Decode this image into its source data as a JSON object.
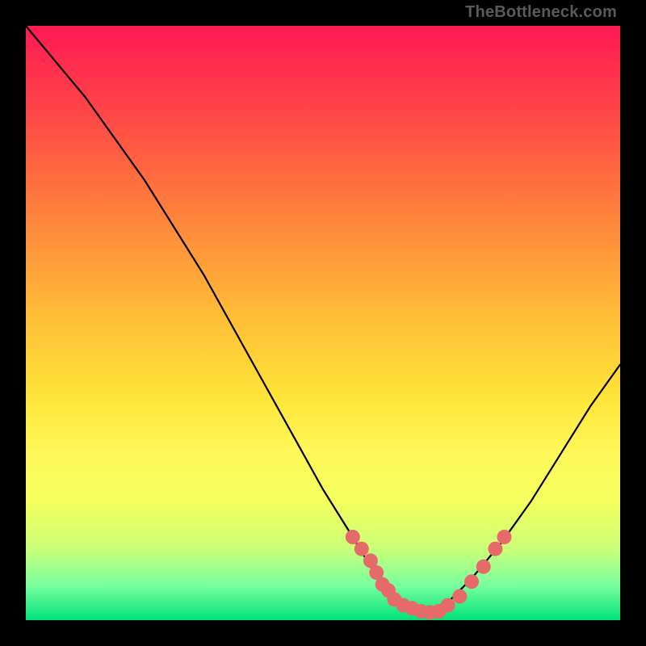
{
  "watermark": "TheBottleneck.com",
  "colors": {
    "frame": "#000000",
    "gradient_top": "#ff1a53",
    "gradient_bottom": "#00e37a",
    "curve": "#000000",
    "marker": "#e66a6a"
  },
  "chart_data": {
    "type": "line",
    "title": "",
    "xlabel": "",
    "ylabel": "",
    "xlim": [
      0,
      100
    ],
    "ylim": [
      0,
      100
    ],
    "x": [
      0,
      5,
      10,
      15,
      20,
      25,
      30,
      35,
      40,
      45,
      50,
      55,
      58,
      60,
      62,
      65,
      68,
      70,
      75,
      80,
      85,
      90,
      95,
      100
    ],
    "values": [
      100,
      94,
      88,
      81,
      74,
      66,
      58,
      49,
      40,
      31,
      22,
      14,
      9,
      6,
      4,
      2,
      1,
      2,
      7,
      13,
      20,
      28,
      36,
      43
    ],
    "markers": [
      {
        "x": 55,
        "y": 14
      },
      {
        "x": 56.5,
        "y": 12
      },
      {
        "x": 58,
        "y": 10
      },
      {
        "x": 59,
        "y": 8
      },
      {
        "x": 60,
        "y": 6
      },
      {
        "x": 61,
        "y": 5
      },
      {
        "x": 62,
        "y": 3.5
      },
      {
        "x": 63.5,
        "y": 2.5
      },
      {
        "x": 65,
        "y": 2
      },
      {
        "x": 66.5,
        "y": 1.5
      },
      {
        "x": 68,
        "y": 1.3
      },
      {
        "x": 69.5,
        "y": 1.5
      },
      {
        "x": 71,
        "y": 2.5
      },
      {
        "x": 73,
        "y": 4
      },
      {
        "x": 75,
        "y": 6.5
      },
      {
        "x": 77,
        "y": 9
      },
      {
        "x": 79,
        "y": 12
      },
      {
        "x": 80.5,
        "y": 14
      }
    ]
  }
}
